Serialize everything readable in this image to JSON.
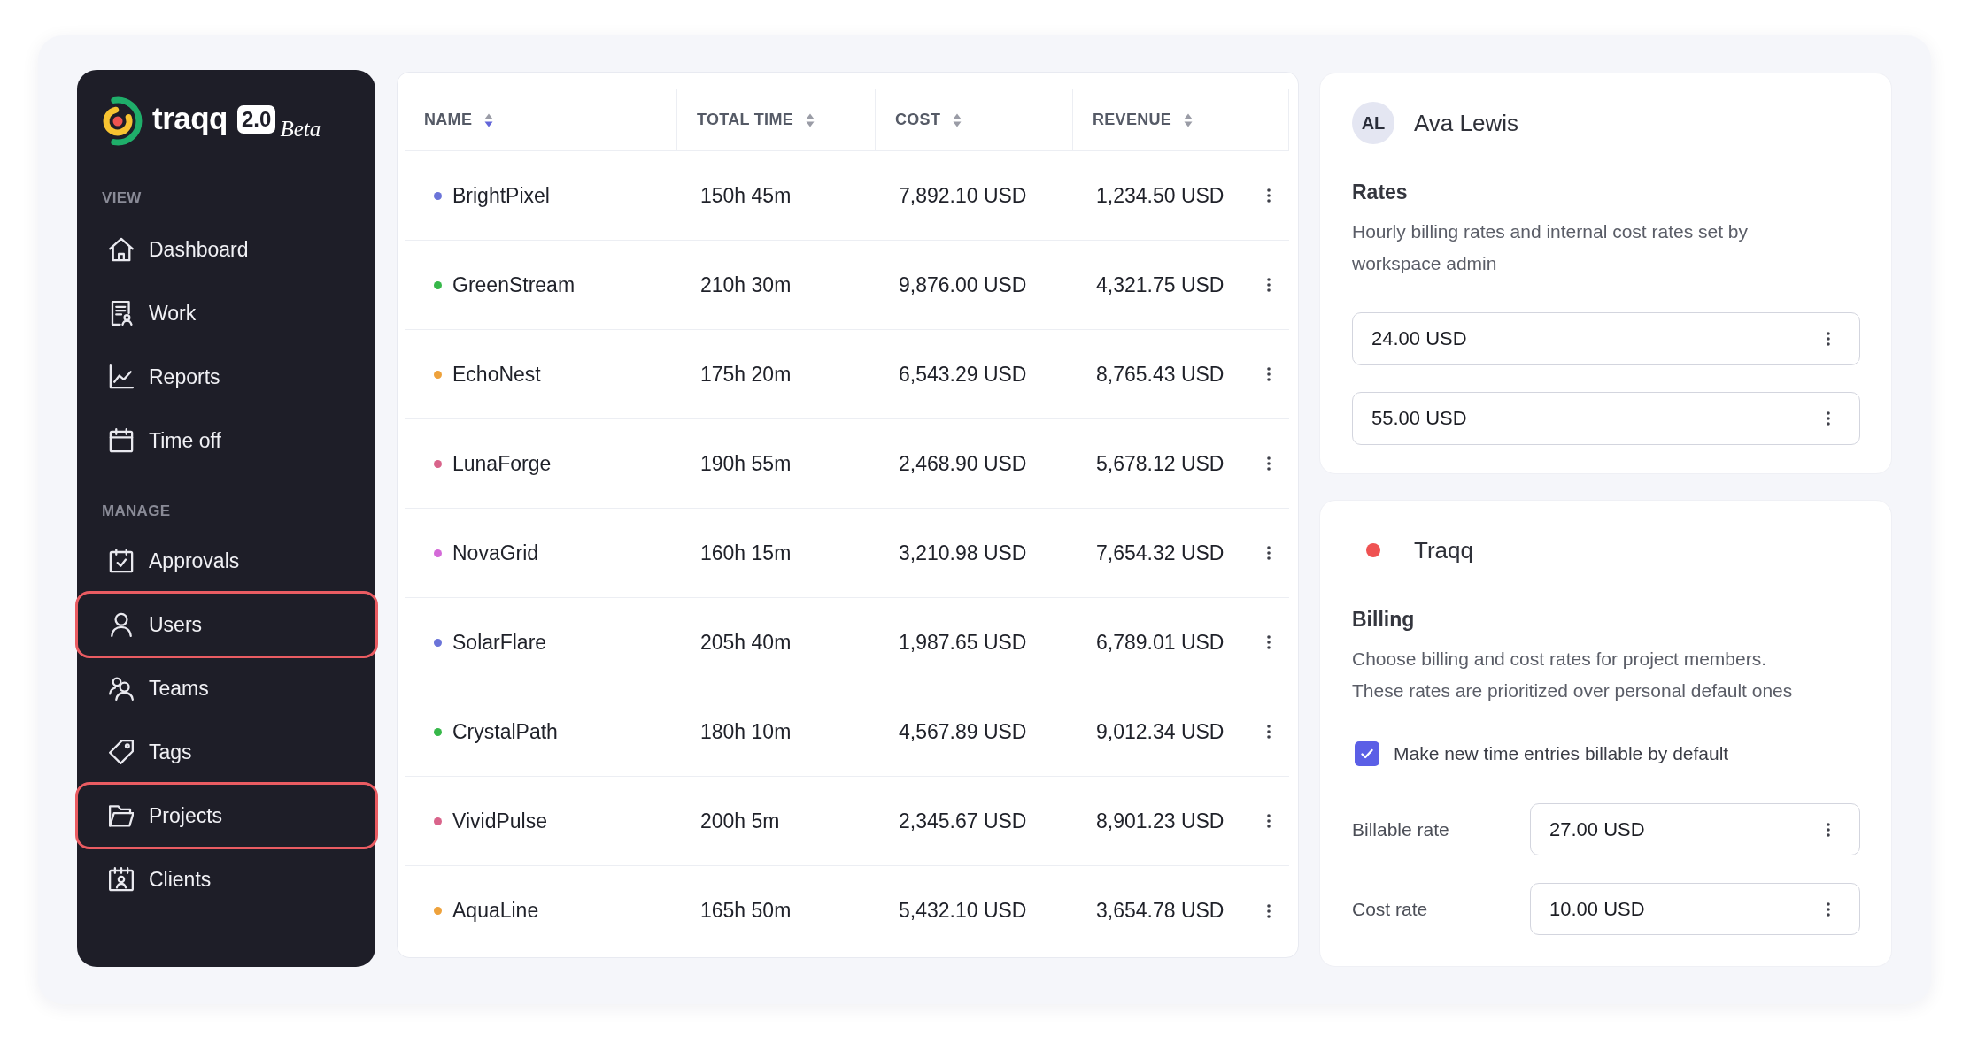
{
  "sidebar": {
    "logo": {
      "wordmark": "traqq",
      "version": "2.0",
      "tag": "Beta"
    },
    "sections": [
      {
        "title": "VIEW",
        "items": [
          {
            "label": "Dashboard",
            "highlighted": false
          },
          {
            "label": "Work",
            "highlighted": false
          },
          {
            "label": "Reports",
            "highlighted": false
          },
          {
            "label": "Time off",
            "highlighted": false
          }
        ]
      },
      {
        "title": "MANAGE",
        "items": [
          {
            "label": "Approvals",
            "highlighted": false
          },
          {
            "label": "Users",
            "highlighted": true
          },
          {
            "label": "Teams",
            "highlighted": false
          },
          {
            "label": "Tags",
            "highlighted": false
          },
          {
            "label": "Projects",
            "highlighted": true
          },
          {
            "label": "Clients",
            "highlighted": false
          }
        ]
      }
    ]
  },
  "table": {
    "columns": [
      {
        "label": "NAME",
        "sorted": true
      },
      {
        "label": "TOTAL TIME",
        "sorted": false
      },
      {
        "label": "COST",
        "sorted": false
      },
      {
        "label": "REVENUE",
        "sorted": false
      }
    ],
    "rows": [
      {
        "name": "BrightPixel",
        "color": "#6b74d9",
        "total_time": "150h 45m",
        "cost": "7,892.10 USD",
        "revenue": "1,234.50 USD"
      },
      {
        "name": "GreenStream",
        "color": "#37b84a",
        "total_time": "210h 30m",
        "cost": "9,876.00 USD",
        "revenue": "4,321.75 USD"
      },
      {
        "name": "EchoNest",
        "color": "#eea23c",
        "total_time": "175h 20m",
        "cost": "6,543.29 USD",
        "revenue": "8,765.43 USD"
      },
      {
        "name": "LunaForge",
        "color": "#d9648b",
        "total_time": "190h 55m",
        "cost": "2,468.90 USD",
        "revenue": "5,678.12 USD"
      },
      {
        "name": "NovaGrid",
        "color": "#d46ad8",
        "total_time": "160h 15m",
        "cost": "3,210.98 USD",
        "revenue": "7,654.32 USD"
      },
      {
        "name": "SolarFlare",
        "color": "#6b74d9",
        "total_time": "205h 40m",
        "cost": "1,987.65 USD",
        "revenue": "6,789.01 USD"
      },
      {
        "name": "CrystalPath",
        "color": "#37b84a",
        "total_time": "180h 10m",
        "cost": "4,567.89 USD",
        "revenue": "9,012.34 USD"
      },
      {
        "name": "VividPulse",
        "color": "#d9648b",
        "total_time": "200h 5m",
        "cost": "2,345.67 USD",
        "revenue": "8,901.23 USD"
      },
      {
        "name": "AquaLine",
        "color": "#eea23c",
        "total_time": "165h 50m",
        "cost": "5,432.10 USD",
        "revenue": "3,654.78 USD"
      }
    ]
  },
  "user_rates": {
    "initials": "AL",
    "name": "Ava Lewis",
    "title": "Rates",
    "description": "Hourly billing rates and internal cost rates set by workspace admin",
    "fields": [
      {
        "value": "24.00 USD"
      },
      {
        "value": "55.00 USD"
      }
    ]
  },
  "project_billing": {
    "color": "#ef5252",
    "name": "Traqq",
    "title": "Billing",
    "description": [
      "Choose billing and cost rates for project members.",
      "These rates are prioritized over personal default ones"
    ],
    "checkbox": {
      "label": "Make new time entries billable by default",
      "checked": true
    },
    "fields": [
      {
        "label": "Billable rate",
        "value": "27.00 USD"
      },
      {
        "label": "Cost rate",
        "value": "10.00 USD"
      }
    ]
  }
}
